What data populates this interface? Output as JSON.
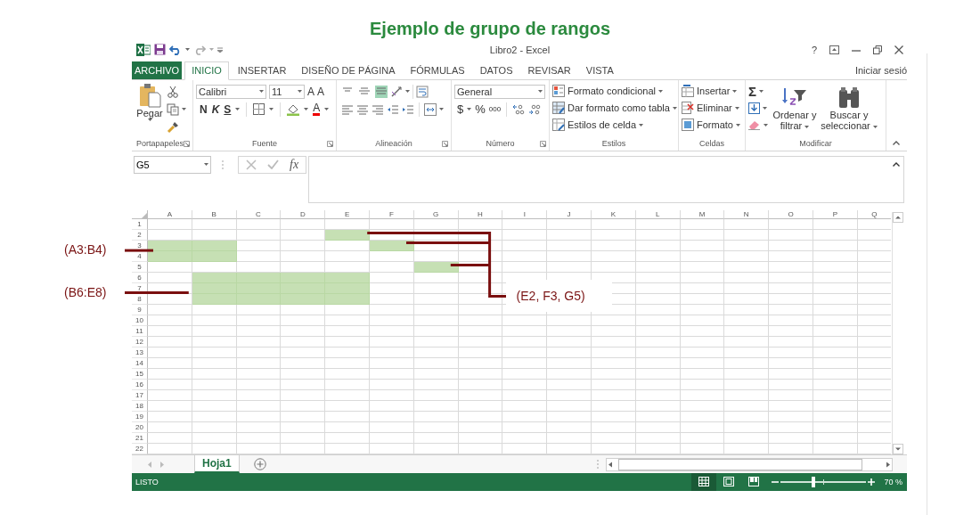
{
  "heading": "Ejemplo de grupo de rangos",
  "window": {
    "title": "Libro2 - Excel",
    "help": "?"
  },
  "tabs": [
    {
      "label": "ARCHIVO",
      "kind": "file",
      "selected": false
    },
    {
      "label": "INICIO",
      "kind": "tab",
      "selected": true
    },
    {
      "label": "INSERTAR",
      "kind": "tab",
      "selected": false
    },
    {
      "label": "DISEÑO DE PÁGINA",
      "kind": "tab",
      "selected": false
    },
    {
      "label": "FÓRMULAS",
      "kind": "tab",
      "selected": false
    },
    {
      "label": "DATOS",
      "kind": "tab",
      "selected": false
    },
    {
      "label": "REVISAR",
      "kind": "tab",
      "selected": false
    },
    {
      "label": "VISTA",
      "kind": "tab",
      "selected": false
    }
  ],
  "sign_in": "Iniciar sesió",
  "ribbon": {
    "clipboard": {
      "label": "Portapapeles",
      "paste": "Pegar"
    },
    "font": {
      "label": "Fuente",
      "name": "Calibri",
      "size": "11",
      "grow": "A",
      "shrink": "A",
      "bold": "N",
      "italic": "K",
      "underline": "S",
      "font_color_letter": "A"
    },
    "alignment": {
      "label": "Alineación",
      "vertical_align": [
        {
          "selected": false
        },
        {
          "selected": false
        },
        {
          "selected": true
        }
      ]
    },
    "number": {
      "label": "Número",
      "format": "General",
      "currency": "$",
      "percent": "%",
      "thousands": "000"
    },
    "styles": {
      "label": "Estilos",
      "buttons": [
        "Formato condicional",
        "Dar formato como tabla",
        "Estilos de celda"
      ]
    },
    "cells": {
      "label": "Celdas",
      "buttons": [
        "Insertar",
        "Eliminar",
        "Formato"
      ]
    },
    "editing": {
      "label": "Modificar",
      "sum": "Σ",
      "buttons": [
        "Ordenar y filtrar",
        "Buscar y seleccionar"
      ]
    }
  },
  "formula_bar": {
    "name_box": "G5",
    "fx": "fx"
  },
  "sheet": {
    "columns": [
      "A",
      "B",
      "C",
      "D",
      "E",
      "F",
      "G",
      "H",
      "I",
      "J",
      "K",
      "L",
      "M",
      "N",
      "O",
      "P",
      "Q"
    ],
    "rows": [
      {
        "label": "1",
        "highlighted": [
          false,
          false,
          false,
          false,
          false,
          false,
          false,
          false,
          false,
          false,
          false,
          false,
          false,
          false,
          false,
          false,
          false
        ]
      },
      {
        "label": "2",
        "highlighted": [
          false,
          false,
          false,
          false,
          true,
          false,
          false,
          false,
          false,
          false,
          false,
          false,
          false,
          false,
          false,
          false,
          false
        ]
      },
      {
        "label": "3",
        "highlighted": [
          true,
          true,
          false,
          false,
          false,
          true,
          false,
          false,
          false,
          false,
          false,
          false,
          false,
          false,
          false,
          false,
          false
        ]
      },
      {
        "label": "4",
        "highlighted": [
          true,
          true,
          false,
          false,
          false,
          false,
          false,
          false,
          false,
          false,
          false,
          false,
          false,
          false,
          false,
          false,
          false
        ]
      },
      {
        "label": "5",
        "highlighted": [
          false,
          false,
          false,
          false,
          false,
          false,
          true,
          false,
          false,
          false,
          false,
          false,
          false,
          false,
          false,
          false,
          false
        ]
      },
      {
        "label": "6",
        "highlighted": [
          false,
          true,
          true,
          true,
          true,
          false,
          false,
          false,
          false,
          false,
          false,
          false,
          false,
          false,
          false,
          false,
          false
        ]
      },
      {
        "label": "7",
        "highlighted": [
          false,
          true,
          true,
          true,
          true,
          false,
          false,
          false,
          false,
          false,
          false,
          false,
          false,
          false,
          false,
          false,
          false
        ]
      },
      {
        "label": "8",
        "highlighted": [
          false,
          true,
          true,
          true,
          true,
          false,
          false,
          false,
          false,
          false,
          false,
          false,
          false,
          false,
          false,
          false,
          false
        ]
      },
      {
        "label": "9",
        "highlighted": [
          false,
          false,
          false,
          false,
          false,
          false,
          false,
          false,
          false,
          false,
          false,
          false,
          false,
          false,
          false,
          false,
          false
        ]
      },
      {
        "label": "10",
        "highlighted": [
          false,
          false,
          false,
          false,
          false,
          false,
          false,
          false,
          false,
          false,
          false,
          false,
          false,
          false,
          false,
          false,
          false
        ]
      },
      {
        "label": "11",
        "highlighted": [
          false,
          false,
          false,
          false,
          false,
          false,
          false,
          false,
          false,
          false,
          false,
          false,
          false,
          false,
          false,
          false,
          false
        ]
      },
      {
        "label": "12",
        "highlighted": [
          false,
          false,
          false,
          false,
          false,
          false,
          false,
          false,
          false,
          false,
          false,
          false,
          false,
          false,
          false,
          false,
          false
        ]
      },
      {
        "label": "13",
        "highlighted": [
          false,
          false,
          false,
          false,
          false,
          false,
          false,
          false,
          false,
          false,
          false,
          false,
          false,
          false,
          false,
          false,
          false
        ]
      },
      {
        "label": "14",
        "highlighted": [
          false,
          false,
          false,
          false,
          false,
          false,
          false,
          false,
          false,
          false,
          false,
          false,
          false,
          false,
          false,
          false,
          false
        ]
      },
      {
        "label": "15",
        "highlighted": [
          false,
          false,
          false,
          false,
          false,
          false,
          false,
          false,
          false,
          false,
          false,
          false,
          false,
          false,
          false,
          false,
          false
        ]
      },
      {
        "label": "16",
        "highlighted": [
          false,
          false,
          false,
          false,
          false,
          false,
          false,
          false,
          false,
          false,
          false,
          false,
          false,
          false,
          false,
          false,
          false
        ]
      },
      {
        "label": "17",
        "highlighted": [
          false,
          false,
          false,
          false,
          false,
          false,
          false,
          false,
          false,
          false,
          false,
          false,
          false,
          false,
          false,
          false,
          false
        ]
      },
      {
        "label": "18",
        "highlighted": [
          false,
          false,
          false,
          false,
          false,
          false,
          false,
          false,
          false,
          false,
          false,
          false,
          false,
          false,
          false,
          false,
          false
        ]
      },
      {
        "label": "19",
        "highlighted": [
          false,
          false,
          false,
          false,
          false,
          false,
          false,
          false,
          false,
          false,
          false,
          false,
          false,
          false,
          false,
          false,
          false
        ]
      },
      {
        "label": "20",
        "highlighted": [
          false,
          false,
          false,
          false,
          false,
          false,
          false,
          false,
          false,
          false,
          false,
          false,
          false,
          false,
          false,
          false,
          false
        ]
      },
      {
        "label": "21",
        "highlighted": [
          false,
          false,
          false,
          false,
          false,
          false,
          false,
          false,
          false,
          false,
          false,
          false,
          false,
          false,
          false,
          false,
          false
        ]
      },
      {
        "label": "22",
        "highlighted": [
          false,
          false,
          false,
          false,
          false,
          false,
          false,
          false,
          false,
          false,
          false,
          false,
          false,
          false,
          false,
          false,
          false
        ]
      }
    ],
    "tabs": [
      {
        "label": "Hoja1",
        "selected": true
      }
    ]
  },
  "status_bar": {
    "text": "LISTO",
    "views": [
      {
        "selected": true
      },
      {
        "selected": false
      },
      {
        "selected": false
      }
    ],
    "zoom": {
      "level": 0.38,
      "reading": "70 %"
    }
  },
  "callouts": [
    {
      "label": "(A3:B4)",
      "kind": "side"
    },
    {
      "label": "(B6:E8)",
      "kind": "side"
    },
    {
      "label": "(E2, F3, G5)",
      "kind": "bracket"
    }
  ]
}
